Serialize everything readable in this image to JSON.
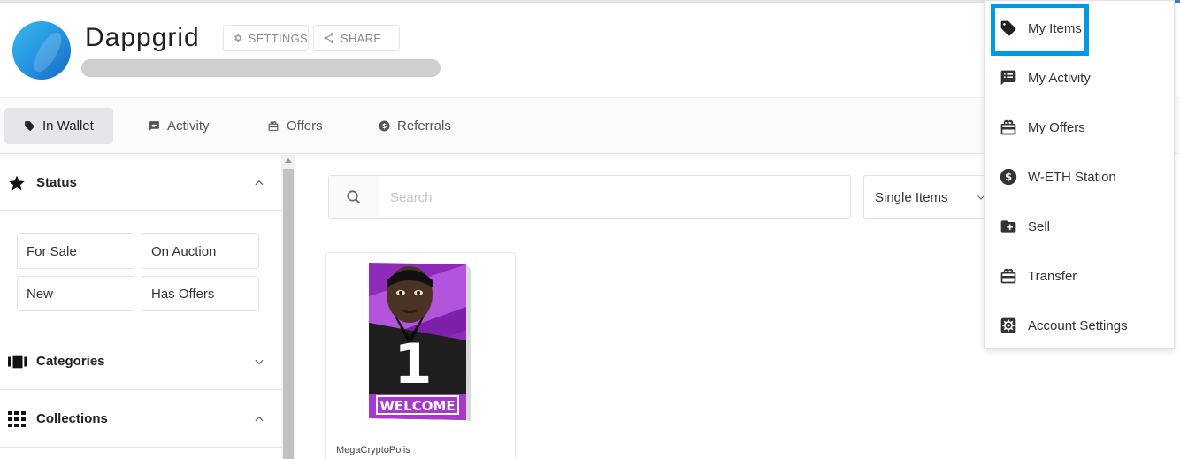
{
  "profile": {
    "name": "Dappgrid"
  },
  "header": {
    "settings_label": "SETTINGS",
    "share_label": "SHARE"
  },
  "tabs": [
    {
      "label": "In Wallet",
      "active": true
    },
    {
      "label": "Activity"
    },
    {
      "label": "Offers"
    },
    {
      "label": "Referrals"
    }
  ],
  "sidebar": {
    "status": {
      "title": "Status",
      "filters": [
        "For Sale",
        "On Auction",
        "New",
        "Has Offers"
      ]
    },
    "categories": {
      "title": "Categories"
    },
    "collections": {
      "title": "Collections"
    }
  },
  "main": {
    "search_placeholder": "Search",
    "item_type_selected": "Single Items",
    "items": [
      {
        "source": "MegaCryptoPolis",
        "art_number": "1",
        "art_banner": "WELCOME"
      }
    ]
  },
  "dropdown": {
    "items": [
      {
        "label": "My Items",
        "icon": "tag-icon",
        "highlighted": true
      },
      {
        "label": "My Activity",
        "icon": "list-chat-icon"
      },
      {
        "label": "My Offers",
        "icon": "gift-icon"
      },
      {
        "label": "W-ETH Station",
        "icon": "dollar-circle-icon"
      },
      {
        "label": "Sell",
        "icon": "folder-plus-icon"
      },
      {
        "label": "Transfer",
        "icon": "gift-icon"
      },
      {
        "label": "Account Settings",
        "icon": "gear-icon"
      }
    ]
  },
  "colors": {
    "accent": "#2f80ed",
    "highlight_border": "#0099e6",
    "card_purple": "#8e2bb8"
  }
}
